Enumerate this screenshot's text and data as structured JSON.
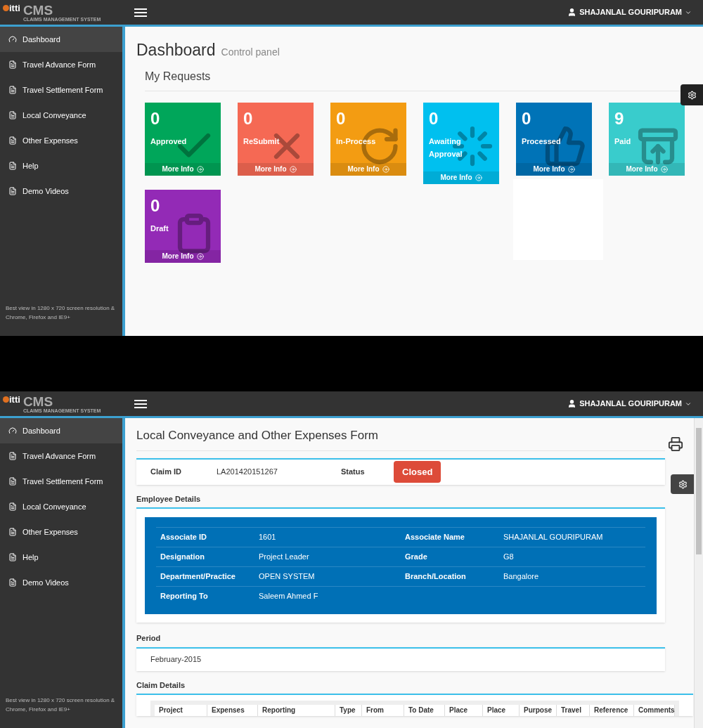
{
  "screens": [
    {
      "kind": "dashboard",
      "header": {
        "logo_mark": "itti",
        "logo_title": "CMS",
        "logo_subtitle": "CLAIMS MANAGEMENT SYSTEM",
        "user": "SHAJANLAL GOURIPURAM"
      },
      "sidebar": {
        "items": [
          {
            "label": "Dashboard",
            "kind": "dashboard",
            "selected": true
          },
          {
            "label": "Travel Advance Form",
            "kind": "form",
            "selected": false
          },
          {
            "label": "Travel Settlement Form",
            "kind": "form",
            "selected": false
          },
          {
            "label": "Local Conveyance",
            "kind": "form",
            "selected": false
          },
          {
            "label": "Other Expenses",
            "kind": "form",
            "selected": false
          },
          {
            "label": "Help",
            "kind": "form",
            "selected": false
          },
          {
            "label": "Demo Videos",
            "kind": "form",
            "selected": false
          }
        ],
        "note": "Best view in 1280 x 720 screen resolution & Chrome, Firefox and IE9+"
      },
      "title": "Dashboard",
      "subtitle": "Control panel",
      "section": "My Requests",
      "tiles": [
        {
          "count": "0",
          "label": "Approved",
          "link": "More Info",
          "color": "#00a65a",
          "kind": "check"
        },
        {
          "count": "0",
          "label": "ReSubmit",
          "link": "More Info",
          "color": "#f56954",
          "kind": "cross"
        },
        {
          "count": "0",
          "label": "In-Process",
          "link": "More Info",
          "color": "#f39c12",
          "kind": "refresh"
        },
        {
          "count": "0",
          "label": "Awaiting Approval",
          "link": "More Info",
          "color": "#00c0ef",
          "kind": "spinner"
        },
        {
          "count": "0",
          "label": "Processed",
          "link": "More Info",
          "color": "#0073b7",
          "kind": "thumb"
        },
        {
          "count": "9",
          "label": "Paid",
          "link": "More Info",
          "color": "#39cccc",
          "kind": "download"
        },
        {
          "count": "0",
          "label": "Draft",
          "link": "More Info",
          "color": "#932ab6",
          "kind": "clipboard"
        }
      ]
    },
    {
      "kind": "form",
      "header": {
        "logo_mark": "itti",
        "logo_title": "CMS",
        "logo_subtitle": "CLAIMS MANAGEMENT SYSTEM",
        "user": "SHAJANLAL GOURIPURAM"
      },
      "sidebar": {
        "items": [
          {
            "label": "Dashboard",
            "kind": "dashboard",
            "selected": true
          },
          {
            "label": "Travel Advance Form",
            "kind": "form",
            "selected": false
          },
          {
            "label": "Travel Settlement Form",
            "kind": "form",
            "selected": false
          },
          {
            "label": "Local Conveyance",
            "kind": "form",
            "selected": false
          },
          {
            "label": "Other Expenses",
            "kind": "form",
            "selected": false
          },
          {
            "label": "Help",
            "kind": "form",
            "selected": false
          },
          {
            "label": "Demo Videos",
            "kind": "form",
            "selected": false
          }
        ],
        "note": "Best view in 1280 x 720 screen resolution & Chrome, Firefox and IE9+"
      },
      "title": "Local Conveyance and Other Expenses Form",
      "claim": {
        "id_label": "Claim ID",
        "id_value": "LA201420151267",
        "status_label": "Status",
        "status": "Closed"
      },
      "employee": {
        "heading": "Employee Details",
        "rows": [
          {
            "cells": [
              "Associate ID",
              "1601",
              "Associate Name",
              "SHAJANLAL GOURIPURAM"
            ]
          },
          {
            "cells": [
              "Designation",
              "Project Leader",
              "Grade",
              "G8"
            ]
          },
          {
            "cells": [
              "Department/Practice",
              "OPEN SYSTEM",
              "Branch/Location",
              "Bangalore"
            ]
          },
          {
            "cells": [
              "Reporting To",
              "Saleem Ahmed F"
            ]
          }
        ]
      },
      "period": {
        "heading": "Period",
        "value": "February-2015"
      },
      "claim_details": {
        "heading": "Claim Details",
        "columns": [
          "Project",
          "Expenses",
          "Reporting",
          "Type",
          "From",
          "To Date",
          "Place",
          "Place",
          "Purpose",
          "Travel",
          "Reference",
          "Comments"
        ]
      }
    }
  ]
}
